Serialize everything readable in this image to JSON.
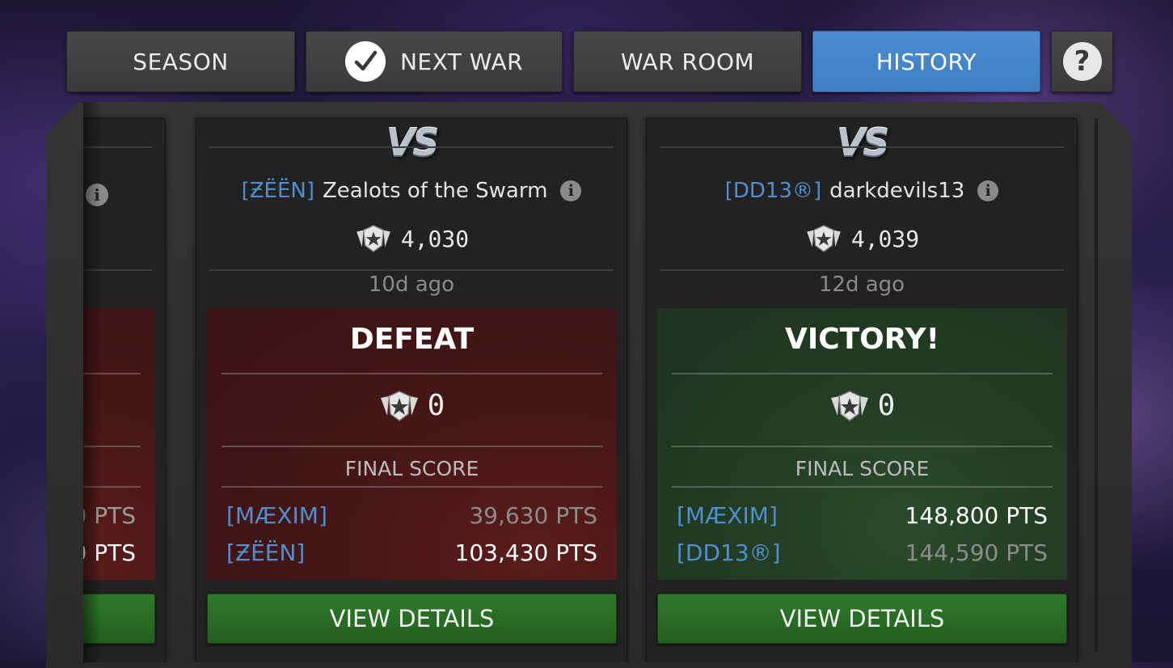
{
  "tabs": [
    {
      "label": "SEASON"
    },
    {
      "label": "NEXT WAR",
      "icon": "check-icon"
    },
    {
      "label": "WAR ROOM"
    },
    {
      "label": "HISTORY",
      "active": true
    }
  ],
  "help": {
    "icon": "help-icon",
    "glyph": "?"
  },
  "colors": {
    "active_tab": "#4a8dd0",
    "defeat": "#451616",
    "victory": "#223a22",
    "tag_blue": "#4f8fd0",
    "button_green": "#2f7a2a"
  },
  "partial_card": {
    "score1": "0 PTS",
    "score2": "0 PTS"
  },
  "cards": [
    {
      "vs": "VS",
      "opponent_tag": "[ƵËËN]",
      "opponent_name": "Zealots of the Swarm",
      "rating": "4,030",
      "ago": "10d ago",
      "result": "DEFEAT",
      "points": "0",
      "final_label": "FINAL SCORE",
      "rows": [
        {
          "tag": "[MÆXIM]",
          "score": "39,630 PTS"
        },
        {
          "tag": "[ƵËËN]",
          "score": "103,430 PTS"
        }
      ],
      "button": "VIEW DETAILS"
    },
    {
      "vs": "VS",
      "opponent_tag": "[DD13®]",
      "opponent_name": "darkdevils13",
      "rating": "4,039",
      "ago": "12d ago",
      "result": "VICTORY!",
      "points": "0",
      "final_label": "FINAL SCORE",
      "rows": [
        {
          "tag": "[MÆXIM]",
          "score": "148,800 PTS"
        },
        {
          "tag": "[DD13®]",
          "score": "144,590 PTS"
        }
      ],
      "button": "VIEW DETAILS"
    }
  ]
}
